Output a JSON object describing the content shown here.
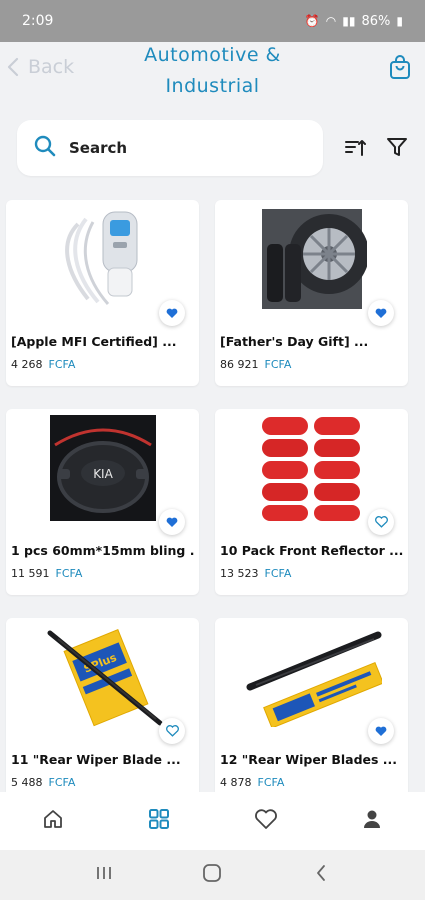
{
  "status_bar": {
    "time": "2:09",
    "battery": "86%"
  },
  "header": {
    "back_label": "Back",
    "title": "Automotive & Industrial"
  },
  "search": {
    "placeholder": "Search"
  },
  "colors": {
    "accent": "#1f8bbd",
    "back_gray": "#c9ced6",
    "favorite_active": "#1f6fd6"
  },
  "products": [
    {
      "name": "[Apple MFI Certified] ...",
      "price": "4 268",
      "currency": "FCFA",
      "favorited": true,
      "image": "usb-car-charger-with-cables"
    },
    {
      "name": "[Father's Day Gift] ...",
      "price": "86 921",
      "currency": "FCFA",
      "favorited": true,
      "image": "tire-inflator-by-car-wheel"
    },
    {
      "name": "1 pcs 60mm*15mm bling ...",
      "price": "11 591",
      "currency": "FCFA",
      "favorited": true,
      "image": "kia-steering-wheel-emblem"
    },
    {
      "name": "10 Pack Front Reflector ...",
      "price": "13 523",
      "currency": "FCFA",
      "favorited": false,
      "image": "red-oval-reflectors"
    },
    {
      "name": "11 \"Rear Wiper Blade ...",
      "price": "5 488",
      "currency": "FCFA",
      "favorited": false,
      "image": "wiper-blade-with-package"
    },
    {
      "name": "12 \"Rear Wiper Blades ...",
      "price": "4 878",
      "currency": "FCFA",
      "favorited": true,
      "image": "wiper-blade-with-yellow-package"
    }
  ],
  "bottom_nav": [
    "home-icon",
    "grid-icon",
    "heart-icon",
    "user-icon"
  ],
  "system_nav": [
    "recent-apps-icon",
    "home-circle-icon",
    "back-chevron-icon"
  ]
}
